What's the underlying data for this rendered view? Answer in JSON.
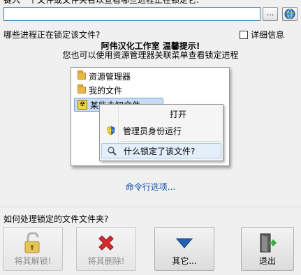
{
  "header": {
    "prompt": "键入一个文件或文件夹名以查看哪些进程正在锁定它:",
    "path_value": "",
    "browse_label": "..."
  },
  "process_section": {
    "label": "哪些进程正在锁定该文件?",
    "details_label": "详细信息",
    "details_checked": false
  },
  "notice": {
    "title": "阿伟汉化工作室 温馨提示!",
    "text": "您也可以使用资源管理器关联菜单查看锁定进程"
  },
  "illustration": {
    "tree": [
      "资源管理器",
      "我的文件",
      "某些未知文件"
    ],
    "menu": [
      "打开",
      "管理员身份运行",
      "什么锁定了该文件?"
    ]
  },
  "cmdline_link": "命令行选项...",
  "action_section": {
    "label": "如何处理锁定的文件文件夹?",
    "buttons": {
      "unlock": "将其解锁!",
      "delete": "将其删除!",
      "other": "其它...",
      "exit": "退出"
    }
  },
  "colors": {
    "accent": "#3c7fb1",
    "link": "#0f4fa6",
    "delete_red": "#d92b2b",
    "other_blue": "#1f62b6"
  }
}
